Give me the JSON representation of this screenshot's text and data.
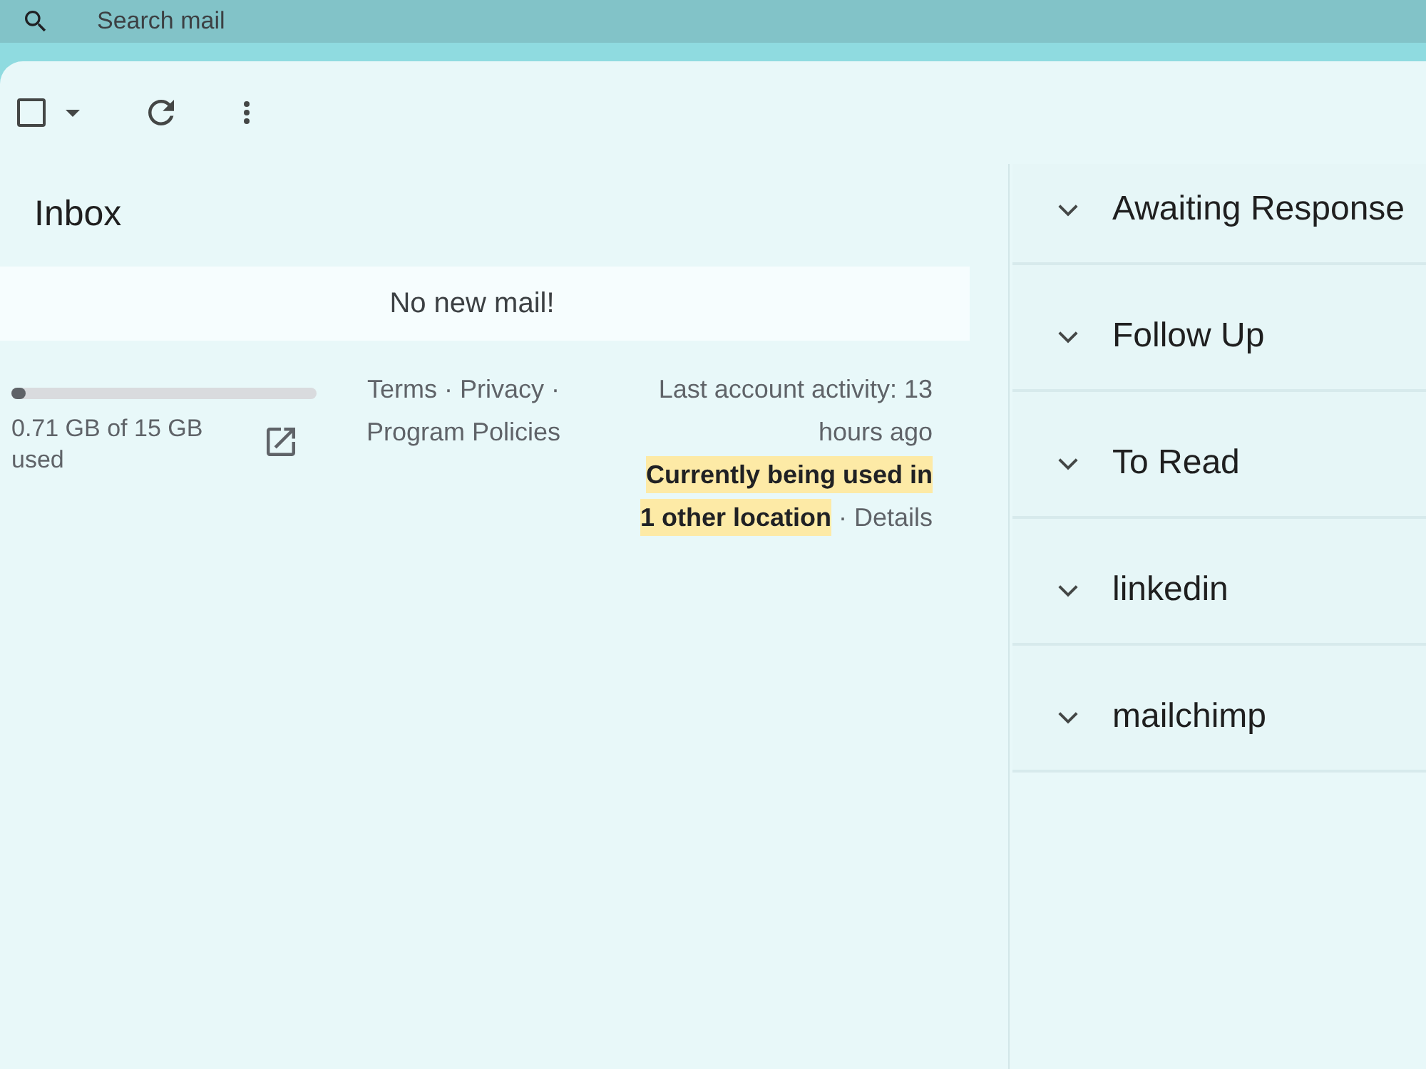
{
  "search": {
    "placeholder": "Search mail"
  },
  "toolbar": {
    "select_all": {
      "checked": false
    }
  },
  "inbox": {
    "title": "Inbox",
    "empty_message": "No new mail!"
  },
  "footer": {
    "storage": {
      "level": 0.047,
      "usage": "0.71 GB of 15 GB used"
    },
    "links": [
      {
        "label": "Terms"
      },
      {
        "label": "Privacy",
        "separator": "·"
      },
      {
        "label": "Program Policies",
        "separator": "·"
      }
    ],
    "activity": "Last account activity: 13 hours ago",
    "session_warning": "Currently being used in 1 other location",
    "details": {
      "label": "Details",
      "separator": "·"
    }
  },
  "sections": [
    {
      "title": "Awaiting Response"
    },
    {
      "title": "Follow Up"
    },
    {
      "title": "To Read"
    },
    {
      "title": "linkedin"
    },
    {
      "title": "mailchimp"
    }
  ]
}
